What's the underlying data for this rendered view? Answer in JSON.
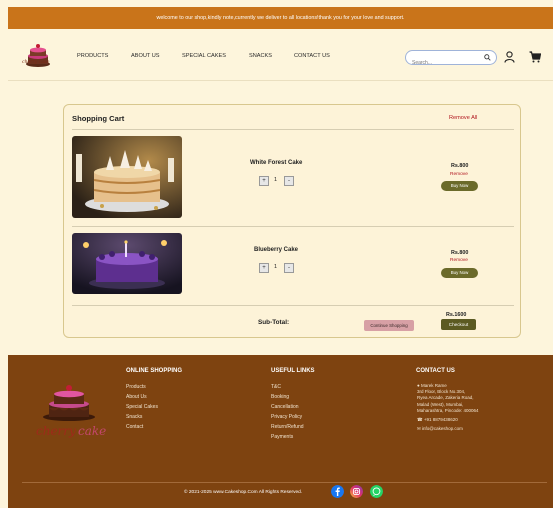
{
  "announcement": "welcome to our shop,kindly note,currently we deliver to all locations!thank you for your love and support.",
  "brand": {
    "logo_text": "cherry cake"
  },
  "nav": {
    "items": [
      "PRODUCTS",
      "ABOUT US",
      "SPECIAL CAKES",
      "SNACKS",
      "CONTACT US"
    ],
    "search_placeholder": "Search..."
  },
  "cart": {
    "title": "Shopping Cart",
    "remove_all": "Remove All",
    "items": [
      {
        "name": "White Forest Cake",
        "qty": "1",
        "price": "Rs.800",
        "remove": "Remove",
        "buy": "Buy Now"
      },
      {
        "name": "Blueberry Cake",
        "qty": "1",
        "price": "Rs.800",
        "remove": "Remove",
        "buy": "Buy Now"
      }
    ],
    "subtotal_label": "Sub-Total:",
    "continue_label": "Continue Shopping",
    "subtotal_value": "Rs.1600",
    "checkout_label": "Checkout"
  },
  "footer": {
    "online_title": "ONLINE SHOPPING",
    "online_links": [
      "Products",
      "About Us",
      "Special Cakes",
      "Snacks",
      "Contact"
    ],
    "useful_title": "USEFUL LINKS",
    "useful_links": [
      "T&C",
      "Booking",
      "Cancellation",
      "Privacy Policy",
      "Return/Refund",
      "Payments"
    ],
    "contact_title": "CONTACT US",
    "contact_name": "Marek Rame",
    "address_lines": [
      "3rd Floor, Block No.304,",
      "Ryea Arcade, Zakeria Road,",
      "Malad (West), Mumbai,",
      "Maharashtra, Pincode: 400064"
    ],
    "phone": "+91 8879438620",
    "email": "info@cakeshop.com",
    "copyright": "© 2021-2025 www.Cakeshop.Com All Rights Reserved."
  },
  "colors": {
    "announce_bg": "#c9741a",
    "footer_bg": "#7e4310",
    "accent_remove": "#b1151e",
    "buy_button": "#6b6a2a",
    "page_bg": "#fdf5dc"
  },
  "icons": [
    "search-icon",
    "user-icon",
    "cart-icon",
    "location-icon",
    "phone-icon",
    "mail-icon",
    "facebook-icon",
    "instagram-icon",
    "whatsapp-icon"
  ]
}
